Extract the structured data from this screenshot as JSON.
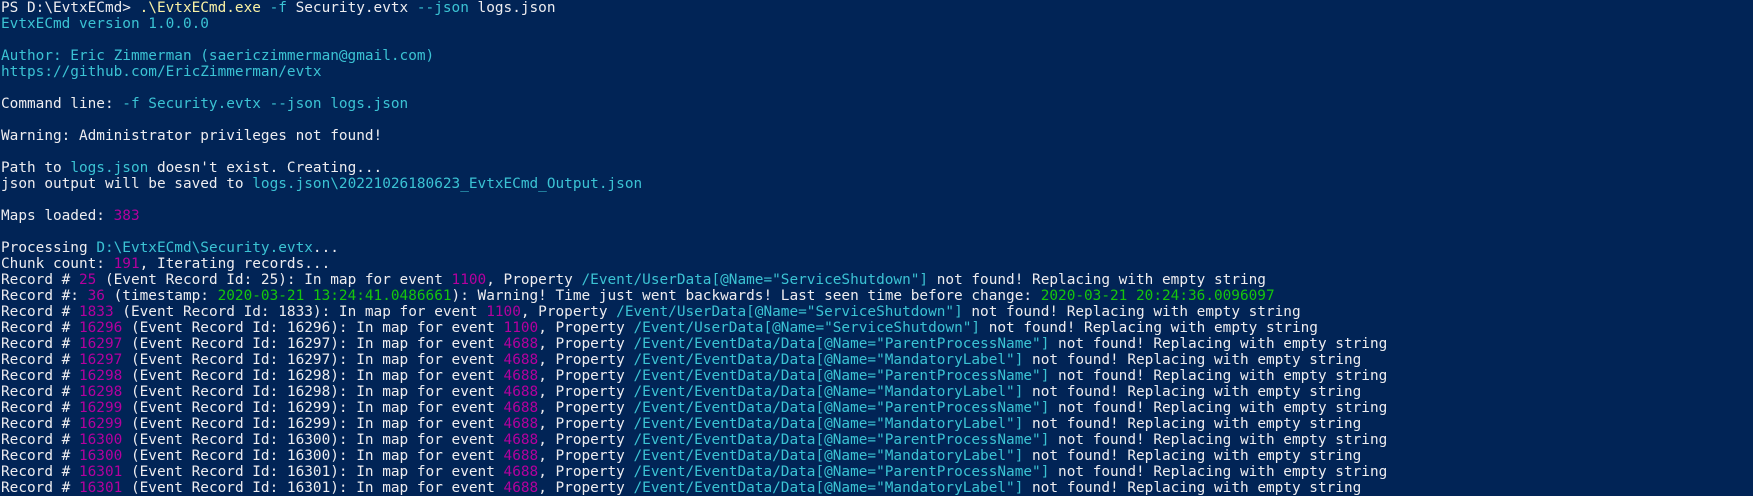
{
  "colors": {
    "background": "#012456",
    "default": "#eeedf0",
    "cyan": "#3bc3d4",
    "magenta": "#b4009e",
    "yellow": "#f9f1a5",
    "green": "#16c60c"
  },
  "lines": [
    {
      "segments": [
        {
          "text": "PS D:\\EvtxECmd> ",
          "color": "default"
        },
        {
          "text": ".\\EvtxECmd.exe",
          "color": "yellow"
        },
        {
          "text": " ",
          "color": "default"
        },
        {
          "text": "-f",
          "color": "cyan"
        },
        {
          "text": " Security.evtx ",
          "color": "default"
        },
        {
          "text": "--json",
          "color": "cyan"
        },
        {
          "text": " logs.json",
          "color": "default"
        }
      ]
    },
    {
      "segments": [
        {
          "text": "EvtxECmd version 1.0.0.0",
          "color": "cyan"
        }
      ]
    },
    {
      "segments": []
    },
    {
      "segments": [
        {
          "text": "Author: Eric Zimmerman (saericzimmerman@gmail.com)",
          "color": "cyan"
        }
      ]
    },
    {
      "segments": [
        {
          "text": "https://github.com/EricZimmerman/evtx",
          "color": "cyan"
        }
      ]
    },
    {
      "segments": []
    },
    {
      "segments": [
        {
          "text": "Command line: ",
          "color": "default"
        },
        {
          "text": "-f Security.evtx --json logs.json",
          "color": "cyan"
        }
      ]
    },
    {
      "segments": []
    },
    {
      "segments": [
        {
          "text": "Warning: Administrator privileges not found!",
          "color": "default"
        }
      ]
    },
    {
      "segments": []
    },
    {
      "segments": [
        {
          "text": "Path to ",
          "color": "default"
        },
        {
          "text": "logs.json",
          "color": "cyan"
        },
        {
          "text": " doesn't exist. Creating...",
          "color": "default"
        }
      ]
    },
    {
      "segments": [
        {
          "text": "json output will be saved to ",
          "color": "default"
        },
        {
          "text": "logs.json\\20221026180623_EvtxECmd_Output.json",
          "color": "cyan"
        }
      ]
    },
    {
      "segments": []
    },
    {
      "segments": [
        {
          "text": "Maps loaded: ",
          "color": "default"
        },
        {
          "text": "383",
          "color": "magenta"
        }
      ]
    },
    {
      "segments": []
    },
    {
      "segments": [
        {
          "text": "Processing ",
          "color": "default"
        },
        {
          "text": "D:\\EvtxECmd\\Security.evtx",
          "color": "cyan"
        },
        {
          "text": "...",
          "color": "default"
        }
      ]
    },
    {
      "segments": [
        {
          "text": "Chunk count: ",
          "color": "default"
        },
        {
          "text": "191",
          "color": "magenta"
        },
        {
          "text": ", Iterating records...",
          "color": "default"
        }
      ]
    },
    {
      "segments": [
        {
          "text": "Record # ",
          "color": "default"
        },
        {
          "text": "25",
          "color": "magenta"
        },
        {
          "text": " (Event Record Id: 25): In map for event ",
          "color": "default"
        },
        {
          "text": "1100",
          "color": "magenta"
        },
        {
          "text": ", Property ",
          "color": "default"
        },
        {
          "text": "/Event/UserData[@Name=\"ServiceShutdown\"]",
          "color": "cyan"
        },
        {
          "text": " not found! Replacing with empty string",
          "color": "default"
        }
      ]
    },
    {
      "segments": [
        {
          "text": "Record #: ",
          "color": "default"
        },
        {
          "text": "36",
          "color": "magenta"
        },
        {
          "text": " (timestamp: ",
          "color": "default"
        },
        {
          "text": "2020-03-21 13:24:41.0486661",
          "color": "green"
        },
        {
          "text": "): Warning! Time just went backwards! Last seen time before change: ",
          "color": "default"
        },
        {
          "text": "2020-03-21 20:24:36.0096097",
          "color": "green"
        }
      ]
    },
    {
      "segments": [
        {
          "text": "Record # ",
          "color": "default"
        },
        {
          "text": "1833",
          "color": "magenta"
        },
        {
          "text": " (Event Record Id: 1833): In map for event ",
          "color": "default"
        },
        {
          "text": "1100",
          "color": "magenta"
        },
        {
          "text": ", Property ",
          "color": "default"
        },
        {
          "text": "/Event/UserData[@Name=\"ServiceShutdown\"]",
          "color": "cyan"
        },
        {
          "text": " not found! Replacing with empty string",
          "color": "default"
        }
      ]
    },
    {
      "segments": [
        {
          "text": "Record # ",
          "color": "default"
        },
        {
          "text": "16296",
          "color": "magenta"
        },
        {
          "text": " (Event Record Id: 16296): In map for event ",
          "color": "default"
        },
        {
          "text": "1100",
          "color": "magenta"
        },
        {
          "text": ", Property ",
          "color": "default"
        },
        {
          "text": "/Event/UserData[@Name=\"ServiceShutdown\"]",
          "color": "cyan"
        },
        {
          "text": " not found! Replacing with empty string",
          "color": "default"
        }
      ]
    },
    {
      "segments": [
        {
          "text": "Record # ",
          "color": "default"
        },
        {
          "text": "16297",
          "color": "magenta"
        },
        {
          "text": " (Event Record Id: 16297): In map for event ",
          "color": "default"
        },
        {
          "text": "4688",
          "color": "magenta"
        },
        {
          "text": ", Property ",
          "color": "default"
        },
        {
          "text": "/Event/EventData/Data[@Name=\"ParentProcessName\"]",
          "color": "cyan"
        },
        {
          "text": " not found! Replacing with empty string",
          "color": "default"
        }
      ]
    },
    {
      "segments": [
        {
          "text": "Record # ",
          "color": "default"
        },
        {
          "text": "16297",
          "color": "magenta"
        },
        {
          "text": " (Event Record Id: 16297): In map for event ",
          "color": "default"
        },
        {
          "text": "4688",
          "color": "magenta"
        },
        {
          "text": ", Property ",
          "color": "default"
        },
        {
          "text": "/Event/EventData/Data[@Name=\"MandatoryLabel\"]",
          "color": "cyan"
        },
        {
          "text": " not found! Replacing with empty string",
          "color": "default"
        }
      ]
    },
    {
      "segments": [
        {
          "text": "Record # ",
          "color": "default"
        },
        {
          "text": "16298",
          "color": "magenta"
        },
        {
          "text": " (Event Record Id: 16298): In map for event ",
          "color": "default"
        },
        {
          "text": "4688",
          "color": "magenta"
        },
        {
          "text": ", Property ",
          "color": "default"
        },
        {
          "text": "/Event/EventData/Data[@Name=\"ParentProcessName\"]",
          "color": "cyan"
        },
        {
          "text": " not found! Replacing with empty string",
          "color": "default"
        }
      ]
    },
    {
      "segments": [
        {
          "text": "Record # ",
          "color": "default"
        },
        {
          "text": "16298",
          "color": "magenta"
        },
        {
          "text": " (Event Record Id: 16298): In map for event ",
          "color": "default"
        },
        {
          "text": "4688",
          "color": "magenta"
        },
        {
          "text": ", Property ",
          "color": "default"
        },
        {
          "text": "/Event/EventData/Data[@Name=\"MandatoryLabel\"]",
          "color": "cyan"
        },
        {
          "text": " not found! Replacing with empty string",
          "color": "default"
        }
      ]
    },
    {
      "segments": [
        {
          "text": "Record # ",
          "color": "default"
        },
        {
          "text": "16299",
          "color": "magenta"
        },
        {
          "text": " (Event Record Id: 16299): In map for event ",
          "color": "default"
        },
        {
          "text": "4688",
          "color": "magenta"
        },
        {
          "text": ", Property ",
          "color": "default"
        },
        {
          "text": "/Event/EventData/Data[@Name=\"ParentProcessName\"]",
          "color": "cyan"
        },
        {
          "text": " not found! Replacing with empty string",
          "color": "default"
        }
      ]
    },
    {
      "segments": [
        {
          "text": "Record # ",
          "color": "default"
        },
        {
          "text": "16299",
          "color": "magenta"
        },
        {
          "text": " (Event Record Id: 16299): In map for event ",
          "color": "default"
        },
        {
          "text": "4688",
          "color": "magenta"
        },
        {
          "text": ", Property ",
          "color": "default"
        },
        {
          "text": "/Event/EventData/Data[@Name=\"MandatoryLabel\"]",
          "color": "cyan"
        },
        {
          "text": " not found! Replacing with empty string",
          "color": "default"
        }
      ]
    },
    {
      "segments": [
        {
          "text": "Record # ",
          "color": "default"
        },
        {
          "text": "16300",
          "color": "magenta"
        },
        {
          "text": " (Event Record Id: 16300): In map for event ",
          "color": "default"
        },
        {
          "text": "4688",
          "color": "magenta"
        },
        {
          "text": ", Property ",
          "color": "default"
        },
        {
          "text": "/Event/EventData/Data[@Name=\"ParentProcessName\"]",
          "color": "cyan"
        },
        {
          "text": " not found! Replacing with empty string",
          "color": "default"
        }
      ]
    },
    {
      "segments": [
        {
          "text": "Record # ",
          "color": "default"
        },
        {
          "text": "16300",
          "color": "magenta"
        },
        {
          "text": " (Event Record Id: 16300): In map for event ",
          "color": "default"
        },
        {
          "text": "4688",
          "color": "magenta"
        },
        {
          "text": ", Property ",
          "color": "default"
        },
        {
          "text": "/Event/EventData/Data[@Name=\"MandatoryLabel\"]",
          "color": "cyan"
        },
        {
          "text": " not found! Replacing with empty string",
          "color": "default"
        }
      ]
    },
    {
      "segments": [
        {
          "text": "Record # ",
          "color": "default"
        },
        {
          "text": "16301",
          "color": "magenta"
        },
        {
          "text": " (Event Record Id: 16301): In map for event ",
          "color": "default"
        },
        {
          "text": "4688",
          "color": "magenta"
        },
        {
          "text": ", Property ",
          "color": "default"
        },
        {
          "text": "/Event/EventData/Data[@Name=\"ParentProcessName\"]",
          "color": "cyan"
        },
        {
          "text": " not found! Replacing with empty string",
          "color": "default"
        }
      ]
    },
    {
      "segments": [
        {
          "text": "Record # ",
          "color": "default"
        },
        {
          "text": "16301",
          "color": "magenta"
        },
        {
          "text": " (Event Record Id: 16301): In map for event ",
          "color": "default"
        },
        {
          "text": "4688",
          "color": "magenta"
        },
        {
          "text": ", Property ",
          "color": "default"
        },
        {
          "text": "/Event/EventData/Data[@Name=\"MandatoryLabel\"]",
          "color": "cyan"
        },
        {
          "text": " not found! Replacing with empty string",
          "color": "default"
        }
      ]
    }
  ]
}
